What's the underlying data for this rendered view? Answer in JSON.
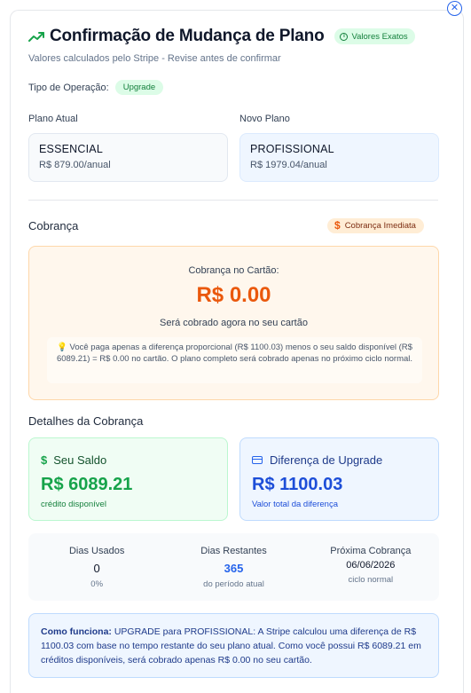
{
  "header": {
    "title": "Confirmação de Mudança de Plano",
    "badge": "Valores Exatos",
    "subtitle": "Valores calculados pelo Stripe - Revise antes de confirmar"
  },
  "operation": {
    "label": "Tipo de Operação:",
    "type": "Upgrade"
  },
  "plans": {
    "current_label": "Plano Atual",
    "current_name": "ESSENCIAL",
    "current_price": "R$ 879.00/anual",
    "new_label": "Novo Plano",
    "new_name": "PROFISSIONAL",
    "new_price": "R$ 1979.04/anual"
  },
  "billing": {
    "title": "Cobrança",
    "badge": "Cobrança Imediata",
    "card_label": "Cobrança no Cartão:",
    "amount": "R$ 0.00",
    "note": "Será cobrado agora no seu cartão",
    "tip_icon": "💡",
    "tip": "Você paga apenas a diferença proporcional (R$ 1100.03) menos o seu saldo disponível (R$ 6089.21) = R$ 0.00 no cartão. O plano completo será cobrado apenas no próximo ciclo normal."
  },
  "details": {
    "title": "Detalhes da Cobrança",
    "balance": {
      "label": "Seu Saldo",
      "value": "R$ 6089.21",
      "sub": "crédito disponível"
    },
    "difference": {
      "label": "Diferença de Upgrade",
      "value": "R$ 1100.03",
      "sub": "Valor total da diferença"
    }
  },
  "days": {
    "used": {
      "label": "Dias Usados",
      "value": "0",
      "sub": "0%"
    },
    "remaining": {
      "label": "Dias Restantes",
      "value": "365",
      "sub": "do período atual"
    },
    "next": {
      "label": "Próxima Cobrança",
      "value": "06/06/2026",
      "sub": "ciclo normal"
    }
  },
  "how": {
    "label": "Como funciona:",
    "text": " UPGRADE para PROFISSIONAL: A Stripe calculou uma diferença de R$ 1100.03 com base no tempo restante do seu plano atual. Como você possui R$ 6089.21 em créditos disponíveis, será cobrado apenas R$ 0.00 no seu cartão."
  },
  "icons": {
    "close": "close-icon",
    "trend": "trending-up-icon",
    "info": "info-icon",
    "dollar": "dollar-icon",
    "card": "credit-card-icon",
    "bulb": "lightbulb-icon"
  },
  "colors": {
    "green": "#16a34a",
    "blue": "#2563eb",
    "orange": "#ea580c"
  }
}
